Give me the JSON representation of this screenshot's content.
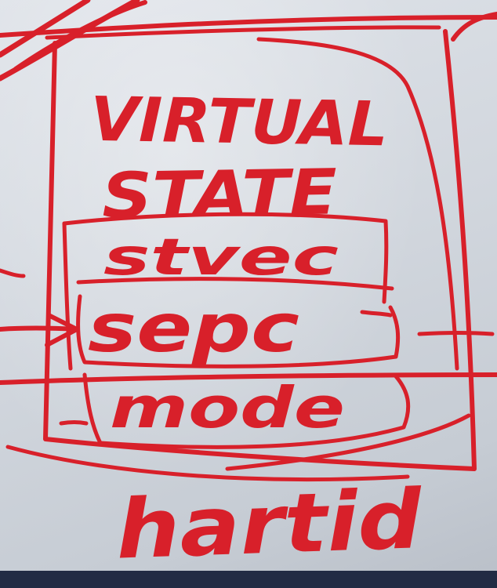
{
  "colors": {
    "ink": "#d8202a",
    "board": "#d6dbe1",
    "frame": "#222b44"
  },
  "labels": {
    "title_line1": "VIRTUAL",
    "title_line2": "STATE",
    "field1": "stvec",
    "field2": "sepc",
    "field3": "mode",
    "outer_label": "hartid"
  }
}
